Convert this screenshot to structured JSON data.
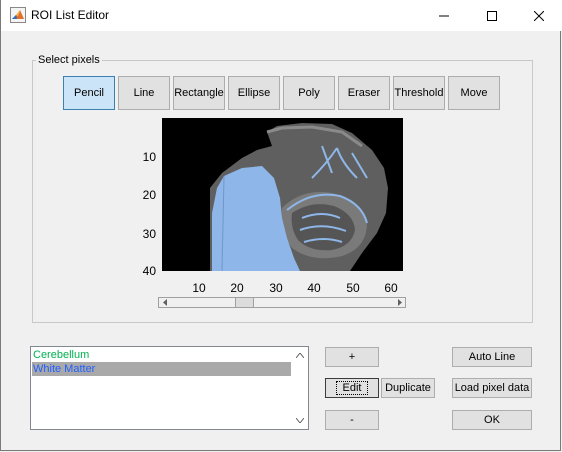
{
  "window": {
    "title": "ROI List Editor",
    "icon": "matlab-icon",
    "controls": [
      "minimize-icon",
      "maximize-icon",
      "close-icon"
    ]
  },
  "select_pixels": {
    "label": "Select pixels",
    "tools": [
      {
        "label": "Pencil",
        "active": true
      },
      {
        "label": "Line",
        "active": false
      },
      {
        "label": "Rectangle",
        "active": false
      },
      {
        "label": "Ellipse",
        "active": false
      },
      {
        "label": "Poly",
        "active": false
      },
      {
        "label": "Eraser",
        "active": false
      },
      {
        "label": "Threshold",
        "active": false
      },
      {
        "label": "Move",
        "active": false
      }
    ]
  },
  "image_axes": {
    "y_ticks": [
      "10",
      "20",
      "30",
      "40"
    ],
    "x_ticks": [
      "10",
      "20",
      "30",
      "40",
      "50",
      "60"
    ]
  },
  "slider": {
    "value_fraction": 0.33
  },
  "roi_list": {
    "items": [
      {
        "label": "Cerebellum",
        "color": "#00b050",
        "selected": false
      },
      {
        "label": "White Matter",
        "color": "#1f5fff",
        "selected": true
      }
    ]
  },
  "buttons": {
    "add": "+",
    "edit": "Edit",
    "duplicate": "Duplicate",
    "remove": "-",
    "auto_line": "Auto Line",
    "load_pixel_data": "Load pixel data",
    "ok": "OK"
  }
}
